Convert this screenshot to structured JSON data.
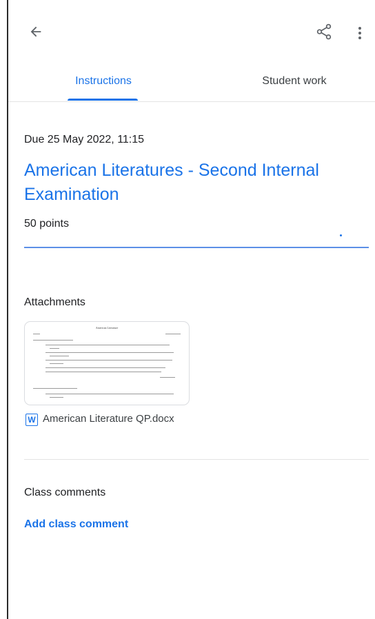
{
  "tabs": {
    "instructions": "Instructions",
    "student_work": "Student work",
    "active": "instructions"
  },
  "assignment": {
    "due": "Due 25 May 2022, 11:15",
    "title": "American Literatures - Second Internal Examination",
    "points": "50 points"
  },
  "attachments": {
    "label": "Attachments",
    "items": [
      {
        "file_name": "American Literature QP.docx",
        "icon": "word-doc-icon",
        "preview_title": "American Literature"
      }
    ]
  },
  "comments": {
    "label": "Class comments",
    "add_link": "Add class comment"
  },
  "icons": {
    "back": "arrow-back-icon",
    "share": "share-icon",
    "more": "more-vert-icon"
  },
  "colors": {
    "accent": "#1a73e8",
    "text": "#202124",
    "divider": "#e3e3e3"
  }
}
